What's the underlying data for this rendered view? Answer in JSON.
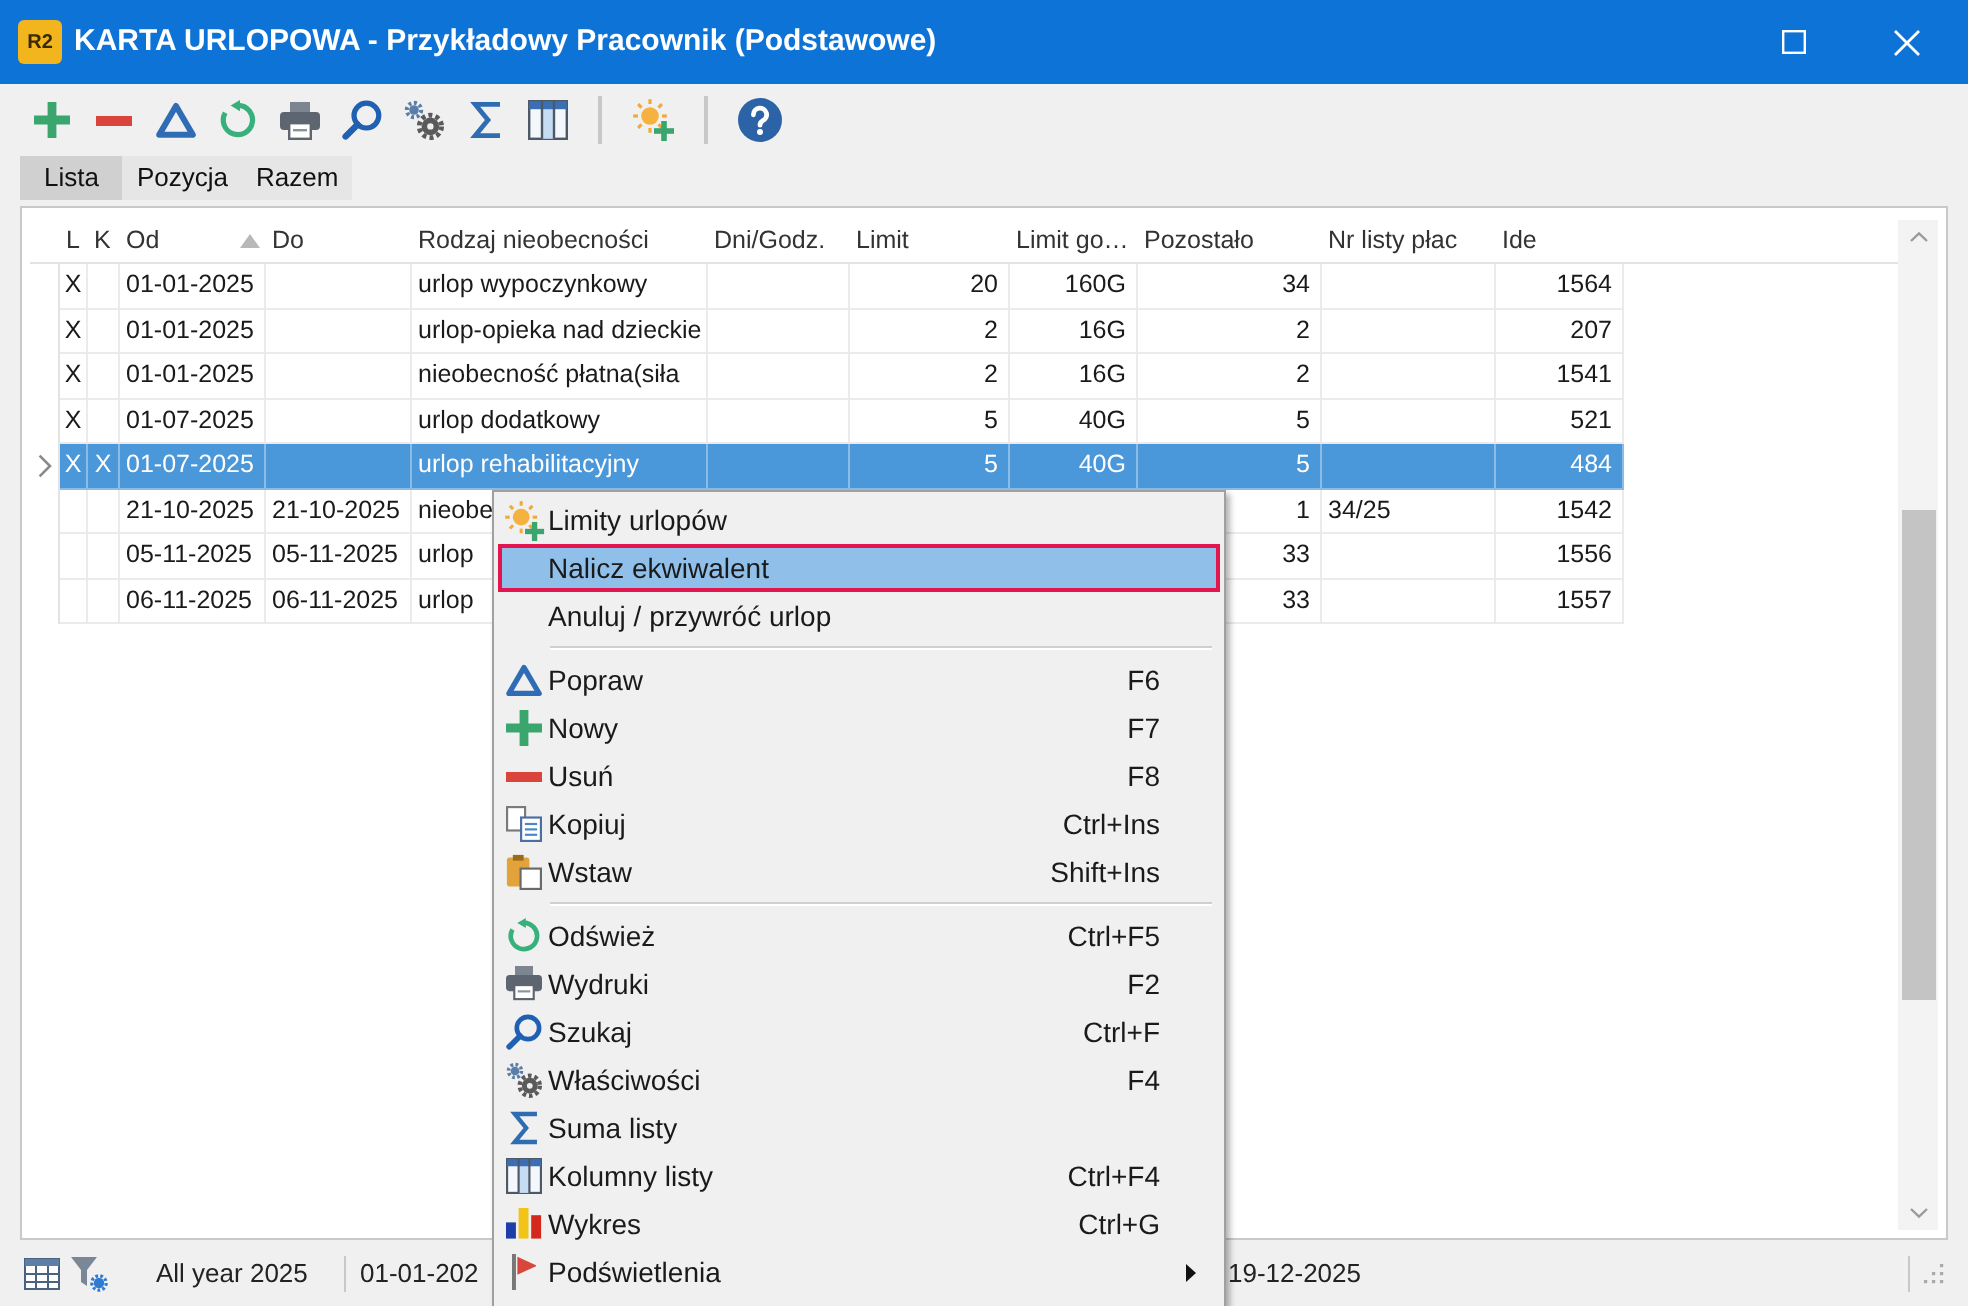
{
  "window": {
    "app_logo": "R2",
    "title": "KARTA URLOPOWA - Przykładowy Pracownik (Podstawowe)"
  },
  "tabs": [
    {
      "label": "Lista",
      "selected": true
    },
    {
      "label": "Pozycja",
      "selected": false
    },
    {
      "label": "Razem",
      "selected": false
    }
  ],
  "table": {
    "columns": [
      {
        "label": "L",
        "kind": "mark"
      },
      {
        "label": "K",
        "kind": "mark"
      },
      {
        "label": "Od",
        "kind": "text",
        "sorted": true
      },
      {
        "label": "Do",
        "kind": "text"
      },
      {
        "label": "Rodzaj nieobecności",
        "kind": "text"
      },
      {
        "label": "Dni/Godz.",
        "kind": "number"
      },
      {
        "label": "Limit",
        "kind": "number"
      },
      {
        "label": "Limit go…",
        "kind": "number"
      },
      {
        "label": "Pozostało",
        "kind": "number"
      },
      {
        "label": "Nr listy płac",
        "kind": "text"
      },
      {
        "label": "Ide",
        "kind": "number"
      }
    ],
    "rows": [
      {
        "selected": false,
        "cells": [
          "X",
          "",
          "01-01-2025",
          "",
          "urlop wypoczynkowy",
          "",
          "20",
          "160G",
          "34",
          "",
          "1564"
        ]
      },
      {
        "selected": false,
        "cells": [
          "X",
          "",
          "01-01-2025",
          "",
          "urlop-opieka nad dzieckie",
          "",
          "2",
          "16G",
          "2",
          "",
          "207"
        ]
      },
      {
        "selected": false,
        "cells": [
          "X",
          "",
          "01-01-2025",
          "",
          "nieobecność płatna(siła",
          "",
          "2",
          "16G",
          "2",
          "",
          "1541"
        ]
      },
      {
        "selected": false,
        "cells": [
          "X",
          "",
          "01-07-2025",
          "",
          "urlop dodatkowy",
          "",
          "5",
          "40G",
          "5",
          "",
          "521"
        ]
      },
      {
        "selected": true,
        "cells": [
          "X",
          "X",
          "01-07-2025",
          "",
          "urlop rehabilitacyjny",
          "",
          "5",
          "40G",
          "5",
          "",
          "484"
        ]
      },
      {
        "selected": false,
        "cells": [
          "",
          "",
          "21-10-2025",
          "21-10-2025",
          "nieobe",
          "",
          "",
          "",
          "1",
          "34/25",
          "1542"
        ]
      },
      {
        "selected": false,
        "cells": [
          "",
          "",
          "05-11-2025",
          "05-11-2025",
          "urlop",
          "",
          "",
          "",
          "33",
          "",
          "1556"
        ]
      },
      {
        "selected": false,
        "cells": [
          "",
          "",
          "06-11-2025",
          "06-11-2025",
          "urlop",
          "",
          "",
          "",
          "33",
          "",
          "1557"
        ]
      }
    ]
  },
  "context_menu": {
    "items": [
      {
        "kind": "item",
        "label": "Limity urlopów",
        "selected": false
      },
      {
        "kind": "item",
        "label": "Nalicz ekwiwalent",
        "selected": true
      },
      {
        "kind": "item",
        "label": "Anuluj / przywróć urlop",
        "selected": false
      },
      {
        "kind": "separator"
      },
      {
        "kind": "item",
        "label": "Popraw",
        "shortcut": "F6",
        "selected": false
      },
      {
        "kind": "item",
        "label": "Nowy",
        "shortcut": "F7",
        "selected": false
      },
      {
        "kind": "item",
        "label": "Usuń",
        "shortcut": "F8",
        "selected": false
      },
      {
        "kind": "item",
        "label": "Kopiuj",
        "shortcut": "Ctrl+Ins",
        "selected": false
      },
      {
        "kind": "item",
        "label": "Wstaw",
        "shortcut": "Shift+Ins",
        "selected": false
      },
      {
        "kind": "separator"
      },
      {
        "kind": "item",
        "label": "Odśwież",
        "shortcut": "Ctrl+F5",
        "selected": false
      },
      {
        "kind": "item",
        "label": "Wydruki",
        "shortcut": "F2",
        "selected": false
      },
      {
        "kind": "item",
        "label": "Szukaj",
        "shortcut": "Ctrl+F",
        "selected": false
      },
      {
        "kind": "item",
        "label": "Właściwości",
        "shortcut": "F4",
        "selected": false
      },
      {
        "kind": "item",
        "label": "Suma listy",
        "selected": false
      },
      {
        "kind": "item",
        "label": "Kolumny listy",
        "shortcut": "Ctrl+F4",
        "selected": false
      },
      {
        "kind": "item",
        "label": "Wykres",
        "shortcut": "Ctrl+G",
        "selected": false
      },
      {
        "kind": "item",
        "label": "Podświetlenia",
        "selected": false,
        "submenu": true
      }
    ]
  },
  "status_bar": {
    "items": [
      "All year 2025",
      "01-01-202",
      "19-12-2025"
    ]
  }
}
